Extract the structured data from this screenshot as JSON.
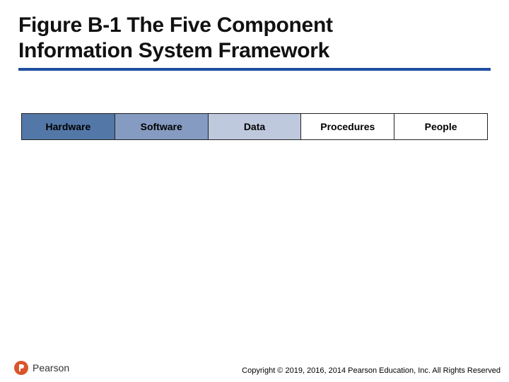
{
  "title": {
    "line1": "Figure B-1 The Five Component",
    "line2": "Information System Framework"
  },
  "framework": {
    "cells": [
      {
        "label": "Hardware"
      },
      {
        "label": "Software"
      },
      {
        "label": "Data"
      },
      {
        "label": "Procedures"
      },
      {
        "label": "People"
      }
    ]
  },
  "logo": {
    "brand": "Pearson"
  },
  "copyright": "Copyright © 2019, 2016, 2014 Pearson Education, Inc. All Rights Reserved"
}
